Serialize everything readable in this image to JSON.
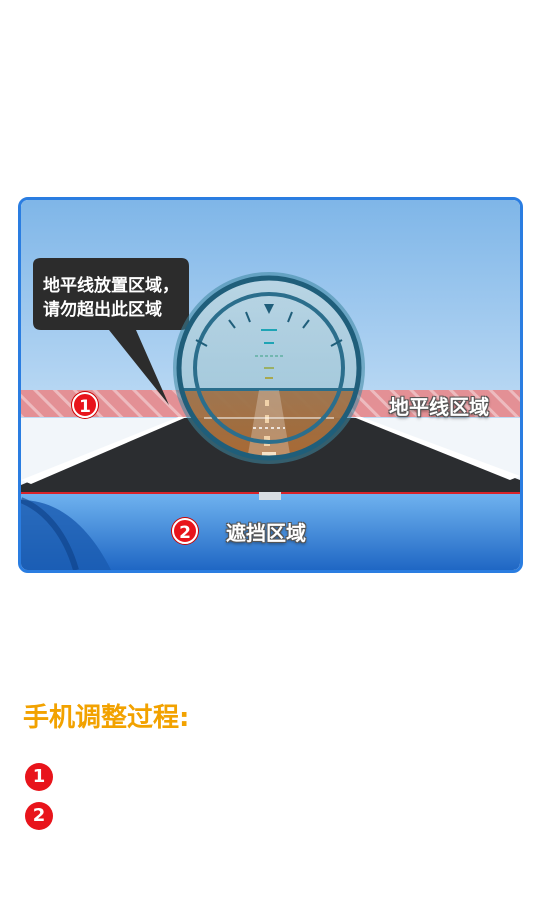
{
  "illustration": {
    "callout_text_line1": "地平线放置区域，",
    "callout_text_line2": "请勿超出此区域",
    "horizon_zone": {
      "number": "1",
      "label": "地平线区域"
    },
    "blocked_zone": {
      "number": "2",
      "label": "遮挡区域"
    }
  },
  "section": {
    "title": "手机调整过程:",
    "steps": [
      {
        "number": "1",
        "text": ""
      },
      {
        "number": "2",
        "text": ""
      }
    ]
  },
  "colors": {
    "frame_border": "#2a7de1",
    "badge_red": "#e8141b",
    "title_orange": "#f2a200",
    "horizon_band": "#e8888a"
  }
}
